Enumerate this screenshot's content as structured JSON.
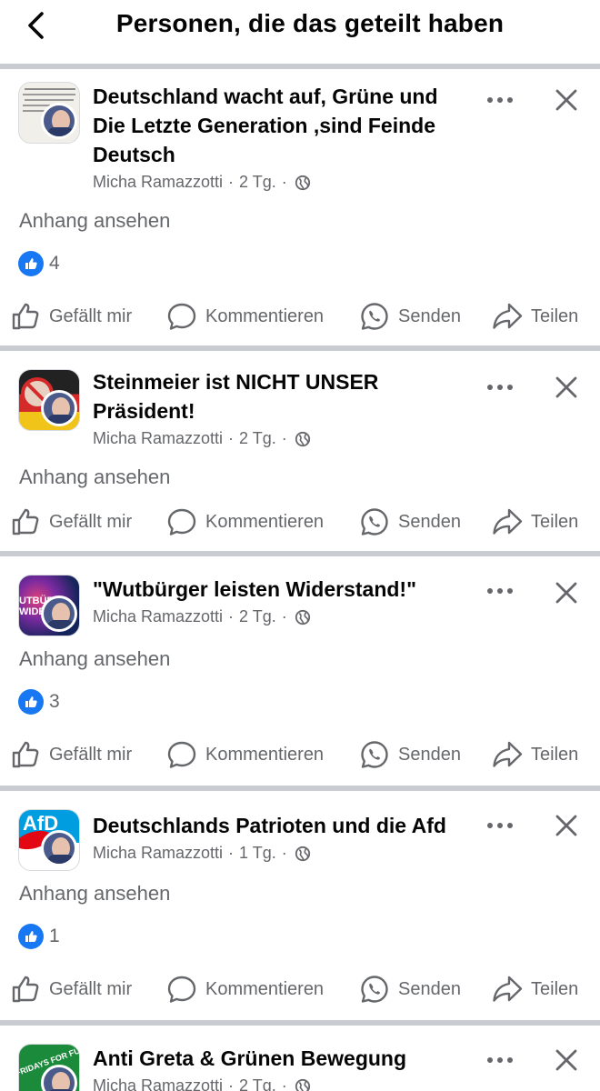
{
  "header": {
    "title": "Personen, die das geteilt haben"
  },
  "actions": {
    "like": "Gefällt mir",
    "comment": "Kommentieren",
    "send": "Senden",
    "share": "Teilen"
  },
  "posts": [
    {
      "title": "Deutschland wacht auf, Grüne und Die Letzte Generation ,sind Feinde Deutsch",
      "author": "Micha Ramazzotti",
      "age": "2 Tg.",
      "attachment": "Anhang ansehen",
      "likes": "4"
    },
    {
      "title": "Steinmeier ist NICHT UNSER Präsident!",
      "author": "Micha Ramazzotti",
      "age": "2 Tg.",
      "attachment": "Anhang ansehen"
    },
    {
      "title": "\"Wutbürger leisten Widerstand!\"",
      "author": "Micha Ramazzotti",
      "age": "2 Tg.",
      "attachment": "Anhang ansehen",
      "likes": "3"
    },
    {
      "title": "Deutschlands Patrioten und die Afd",
      "author": "Micha Ramazzotti",
      "age": "1 Tg.",
      "attachment": "Anhang ansehen",
      "likes": "1"
    },
    {
      "title": "Anti Greta & Grünen Bewegung",
      "author": "Micha Ramazzotti",
      "age": "2 Tg."
    }
  ],
  "thumbnails": {
    "thumb3_text": "UTBÜRG\nWIDE",
    "thumb4_text": "AfD",
    "thumb5_text": "FRIDAYS FOR FU"
  },
  "colors": {
    "accent": "#1877f2",
    "secondary_text": "#65676b",
    "separator": "#c9ccd1"
  }
}
